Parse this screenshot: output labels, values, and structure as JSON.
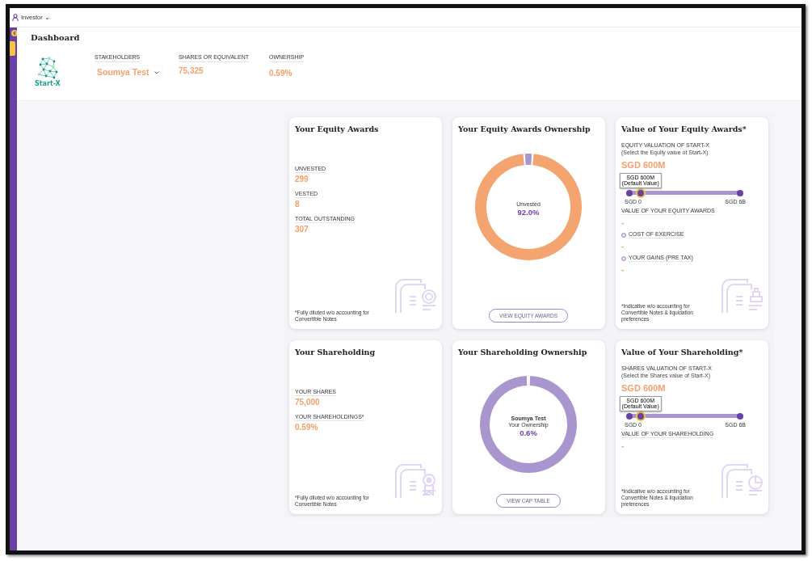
{
  "topbar": {
    "role": "Investor",
    "caret": "⌄"
  },
  "header": {
    "title": "Dashboard",
    "logo_text": "Start-X",
    "stats": [
      {
        "label": "STAKEHOLDERS",
        "value": "Soumya Test",
        "kind": "dropdown"
      },
      {
        "label": "SHARES OR EQUIVALENT",
        "value": "75,325",
        "kind": "plain"
      },
      {
        "label": "OWNERSHIP",
        "value": "0.59%",
        "kind": "plain"
      }
    ]
  },
  "cards": [
    {
      "kind": "stats",
      "title": "Your Equity Awards",
      "items": [
        {
          "label": "UNVESTED",
          "value": "299"
        },
        {
          "label": "VESTED",
          "value": "8"
        },
        {
          "label": "TOTAL OUTSTANDING",
          "value": "307"
        }
      ],
      "footnote": "*Fully diluted w/o accounting for Convertible Notes"
    },
    {
      "kind": "donut",
      "title": "Your Equity Awards Ownership",
      "center": [
        "Unvested"
      ],
      "center_value": "92.0%",
      "button": "VIEW EQUITY AWARDS"
    },
    {
      "kind": "valuation",
      "title": "Value of Your Equity Awards*",
      "label": "EQUITY VALUATION OF START-X",
      "hint": "(Select the Equity value of Start-X)",
      "value": "SGD 600M",
      "slider": {
        "level": 0.1,
        "tooltip": [
          "SGD 600M",
          "(Default Value)"
        ],
        "min_label": "SGD 0",
        "max_label": "SGD 6B"
      },
      "results": [
        {
          "label": "VALUE OF YOUR EQUITY AWARDS",
          "value": "-",
          "marker": false
        },
        {
          "label": "COST OF EXERCISE",
          "value": "-",
          "marker": true
        },
        {
          "label": "YOUR GAINS (PRE TAX)",
          "value": "-",
          "marker": true
        }
      ],
      "footnote": "*Indicative w/o accounting for Convertible Notes & liquidation preferences"
    },
    {
      "kind": "stats",
      "title": "Your Shareholding",
      "items": [
        {
          "label": "YOUR SHARES",
          "value": "75,000"
        },
        {
          "label": "YOUR SHAREHOLDINGS*",
          "value": "0.59%"
        }
      ],
      "footnote": "*Fully diluted w/o accounting for Convertible Notes"
    },
    {
      "kind": "donut",
      "title": "Your Shareholding Ownership",
      "center": [
        "Soumya Test",
        "Your Ownership"
      ],
      "center_value": "0.6%",
      "button": "VIEW CAP TABLE"
    },
    {
      "kind": "valuation",
      "title": "Value of Your Shareholding*",
      "label": "SHARES VALUATION OF START-X",
      "hint": "(Select the Shares value of Start-X)",
      "value": "SGD 600M",
      "slider": {
        "level": 0.1,
        "tooltip": [
          "SGD 600M",
          "(Default Value)"
        ],
        "min_label": "SGD 0",
        "max_label": "SGD 6B"
      },
      "results": [
        {
          "label": "VALUE OF YOUR SHAREHOLDING",
          "value": "-",
          "marker": false
        }
      ],
      "footnote": "*Indicative w/o accounting for Convertible Notes & liquidation preferences"
    }
  ]
}
